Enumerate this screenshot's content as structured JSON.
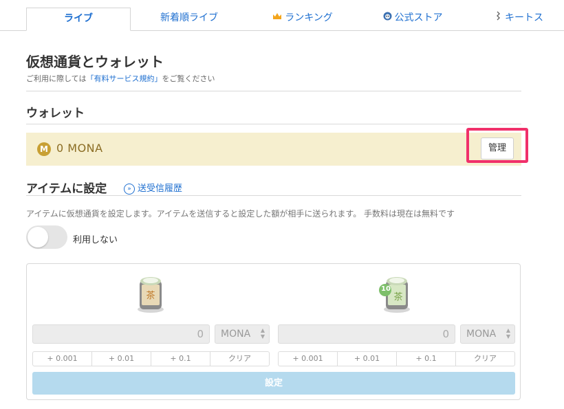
{
  "tabs": [
    {
      "label": "ライブ",
      "active": true
    },
    {
      "label": "新着順ライブ"
    },
    {
      "label": "ランキング",
      "icon": "crown-icon"
    },
    {
      "label": "公式ストア",
      "icon": "store-mascot-icon"
    },
    {
      "label": "キートス",
      "icon": "kiitos-icon"
    }
  ],
  "page": {
    "title": "仮想通貨とウォレット",
    "notice_prefix": "ご利用に際しては",
    "notice_link": "「有料サービス規約」",
    "notice_suffix": "をご覧ください"
  },
  "wallet": {
    "heading": "ウォレット",
    "coin_symbol": "M",
    "balance": "0 MONA",
    "manage_label": "管理"
  },
  "item_settings": {
    "heading": "アイテムに設定",
    "history_link": "送受信履歴",
    "description": "アイテムに仮想通貨を設定します。アイテムを送信すると設定した額が相手に送られます。 手数料は現在は無料です",
    "toggle_label": "利用しない",
    "items": [
      {
        "name": "tea",
        "badge": "",
        "amount": "0",
        "currency": "MONA"
      },
      {
        "name": "tea-10",
        "badge": "10",
        "amount": "0",
        "currency": "MONA"
      }
    ],
    "increments": [
      "+ 0.001",
      "+ 0.01",
      "+ 0.1",
      "クリア"
    ],
    "submit_label": "設定"
  },
  "colors": {
    "accent": "#1e6fd0",
    "wallet_bg": "#f6efcf",
    "highlight": "#f0306a",
    "submit_bg": "#b5daee"
  }
}
